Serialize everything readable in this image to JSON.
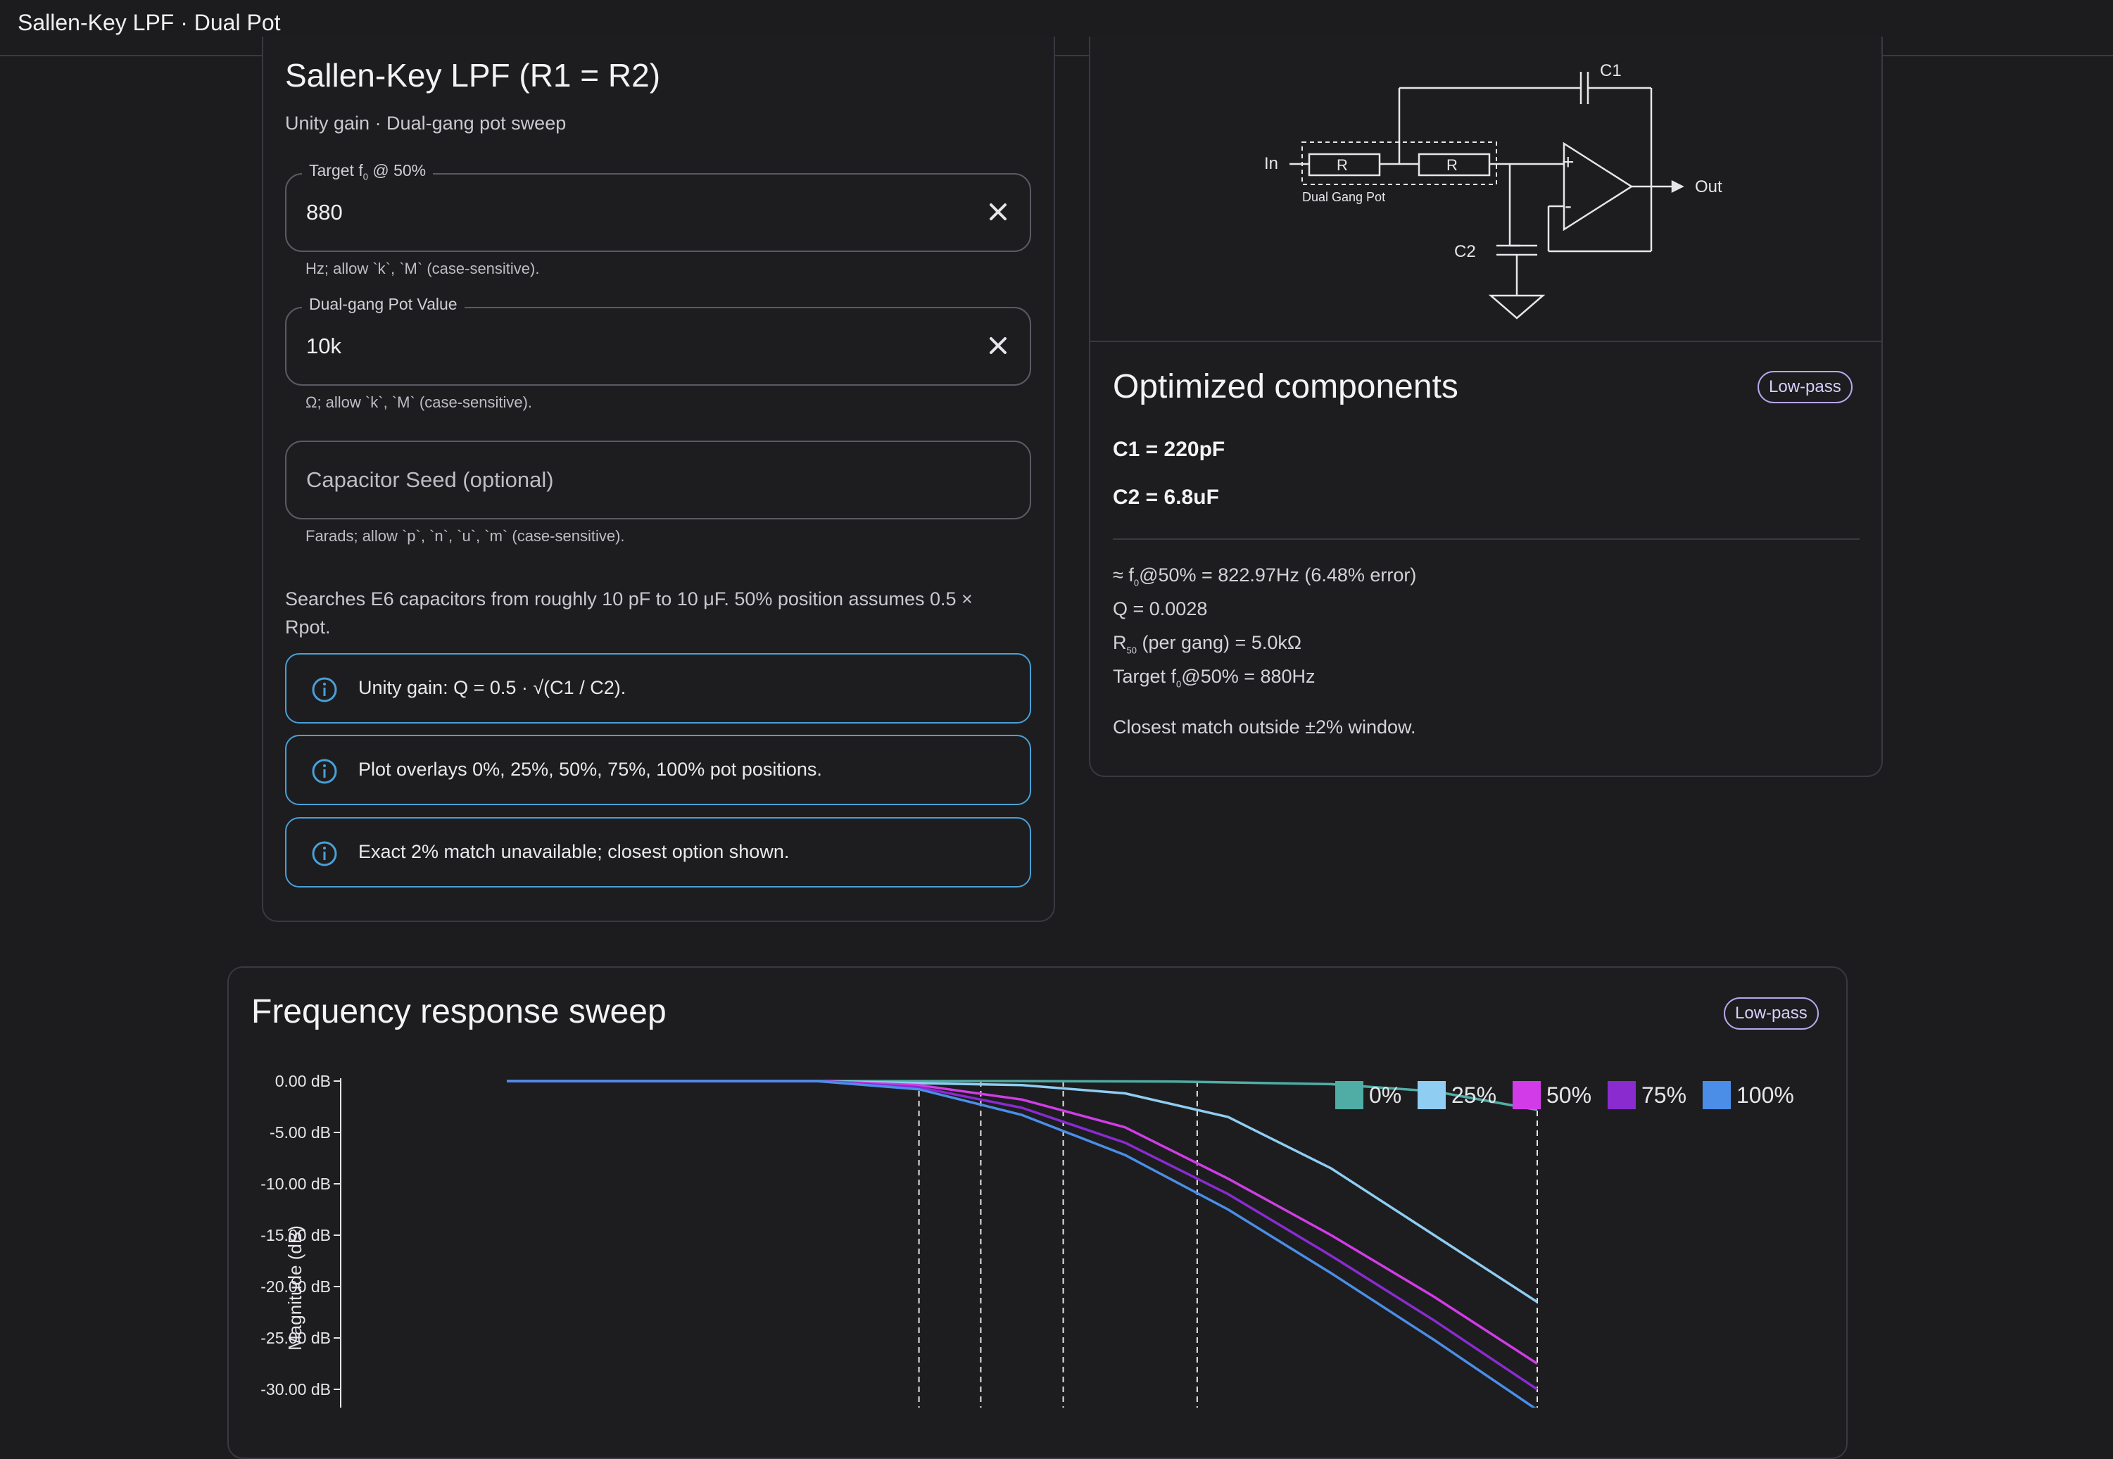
{
  "app": {
    "title": "Sallen-Key LPF · Dual Pot"
  },
  "form": {
    "title": "Sallen-Key LPF (R1 = R2)",
    "subtitle": "Unity gain · Dual-gang pot sweep",
    "target": {
      "label_main": "Target f",
      "label_sub": "0",
      "label_tail": " @ 50%",
      "value": "880",
      "helper": "Hz; allow `k`, `M` (case-sensitive)."
    },
    "pot": {
      "label": "Dual-gang Pot Value",
      "value": "10k",
      "helper": "Ω; allow `k`, `M` (case-sensitive)."
    },
    "cap": {
      "placeholder": "Capacitor Seed (optional)",
      "helper": "Farads; allow `p`, `n`, `u`, `m` (case-sensitive)."
    },
    "note_line1": "Searches E6 capacitors from roughly 10 pF to 10 μF. 50% position assumes 0.5 ×",
    "note_line2": "Rpot.",
    "infos": [
      "Unity gain: Q = 0.5 · √(C1 / C2).",
      "Plot overlays 0%, 25%, 50%, 75%, 100% pot positions.",
      "Exact 2% match unavailable; closest option shown."
    ]
  },
  "schematic": {
    "c1": "C1",
    "c2": "C2",
    "r1": "R",
    "r2": "R",
    "in": "In",
    "out": "Out",
    "pot_label": "Dual Gang Pot",
    "plus": "+",
    "minus": "-"
  },
  "results": {
    "title": "Optimized components",
    "chip": "Low-pass",
    "c1": "C1 = 220pF",
    "c2": "C2 = 6.8uF",
    "f0_pre": "≈ f",
    "f0_sub": "0",
    "f0_post": "@50% = 822.97Hz (6.48% error)",
    "q": "Q = 0.0028",
    "r50_pre": "R",
    "r50_sub": "50",
    "r50_post": " (per gang) = 5.0kΩ",
    "target_pre": "Target f",
    "target_sub": "0",
    "target_post": "@50% = 880Hz",
    "match_note": "Closest match outside ±2% window."
  },
  "plot": {
    "title": "Frequency response sweep",
    "chip": "Low-pass",
    "legend": [
      {
        "label": "0%",
        "color": "#4fada5"
      },
      {
        "label": "25%",
        "color": "#8fcdf2"
      },
      {
        "label": "50%",
        "color": "#d23ce8"
      },
      {
        "label": "75%",
        "color": "#8a2bd0"
      },
      {
        "label": "100%",
        "color": "#4a8ee8"
      }
    ]
  },
  "chart_data": {
    "type": "line",
    "title": "Frequency response sweep",
    "xlabel": "",
    "ylabel": "Magnitude (dB)",
    "yticks": [
      "0.00 dB",
      "-5.00 dB",
      "-10.00 dB",
      "-15.00 dB",
      "-20.00 dB",
      "-25.00 dB",
      "-30.00 dB"
    ],
    "ylim": [
      -30,
      0
    ],
    "x_scale": "log",
    "series": [
      {
        "name": "0%",
        "color": "#4fada5",
        "x": [
          0.0,
          0.3,
          0.5,
          0.65,
          0.8,
          0.9,
          1.0
        ],
        "y": [
          0.0,
          0.0,
          0.0,
          -0.05,
          -0.3,
          -1.0,
          -2.8
        ]
      },
      {
        "name": "25%",
        "color": "#8fcdf2",
        "x": [
          0.0,
          0.3,
          0.5,
          0.6,
          0.7,
          0.8,
          0.9,
          1.0
        ],
        "y": [
          0.0,
          0.0,
          -0.4,
          -1.2,
          -3.5,
          -8.5,
          -15.0,
          -21.5
        ]
      },
      {
        "name": "50%",
        "color": "#d23ce8",
        "x": [
          0.0,
          0.3,
          0.4,
          0.5,
          0.6,
          0.7,
          0.8,
          0.9,
          1.0
        ],
        "y": [
          0.0,
          0.0,
          -0.4,
          -1.8,
          -4.5,
          -9.5,
          -15.0,
          -21.0,
          -27.5
        ]
      },
      {
        "name": "75%",
        "color": "#8a2bd0",
        "x": [
          0.0,
          0.3,
          0.4,
          0.5,
          0.6,
          0.7,
          0.8,
          0.9,
          1.0
        ],
        "y": [
          0.0,
          0.0,
          -0.6,
          -2.6,
          -6.0,
          -11.0,
          -17.0,
          -23.3,
          -30.0
        ]
      },
      {
        "name": "100%",
        "color": "#4a8ee8",
        "x": [
          0.0,
          0.3,
          0.4,
          0.5,
          0.6,
          0.7,
          0.8,
          0.9,
          1.0
        ],
        "y": [
          0.0,
          0.0,
          -0.8,
          -3.3,
          -7.2,
          -12.5,
          -18.7,
          -25.2,
          -32.0
        ]
      }
    ],
    "markers": [
      0.4,
      0.46,
      0.54,
      0.67,
      1.0
    ],
    "legend_position": "top-right",
    "grid": false
  }
}
